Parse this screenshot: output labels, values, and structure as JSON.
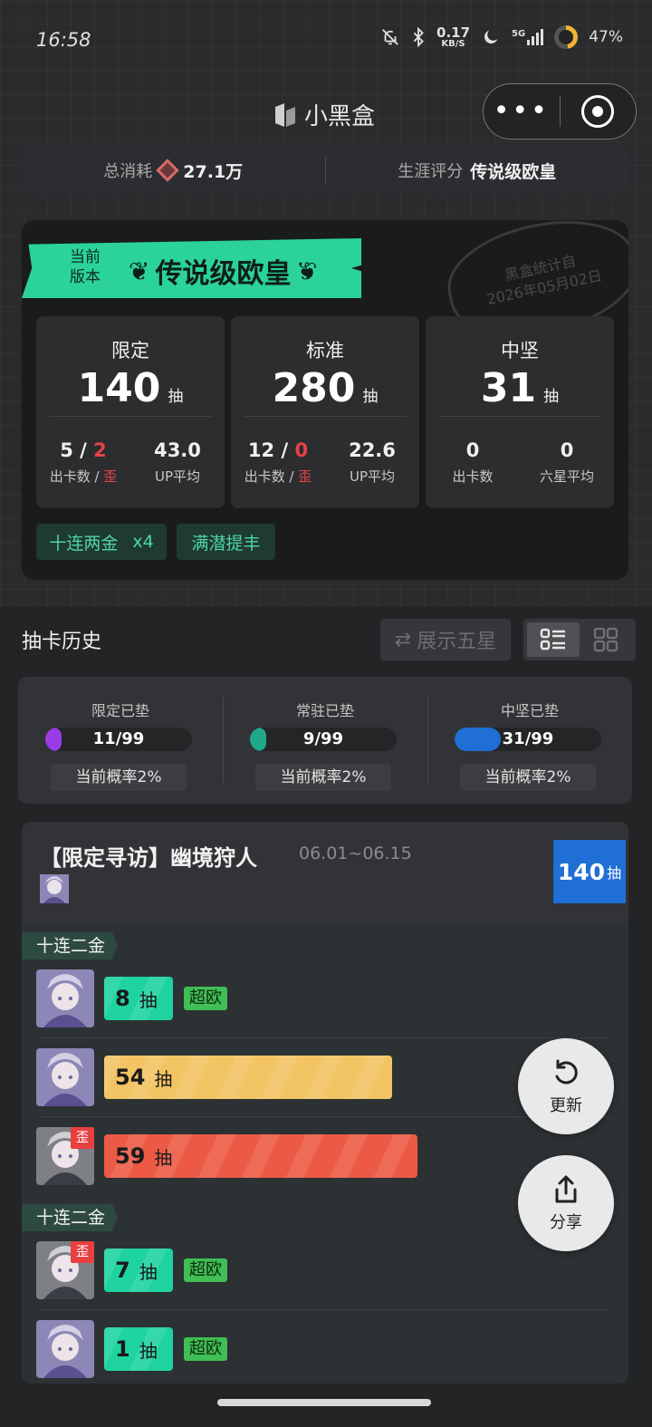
{
  "status_bar": {
    "time": "16:58",
    "net_speed": "0.17",
    "net_unit": "KB/S",
    "signal": "5G",
    "battery": "47%"
  },
  "header": {
    "app_name": "小黑盒",
    "menu_label": "•••"
  },
  "summary": {
    "consume_label": "总消耗",
    "consume_value": "27.1万",
    "score_label": "生涯评分",
    "score_value": "传说级欧皇"
  },
  "version_card": {
    "banner_sub": "当前版本",
    "banner_title": "传说级欧皇",
    "stamp_line1": "黑盒统计自",
    "stamp_line2": "2026年05月02日",
    "stats": [
      {
        "title": "限定",
        "pulls": "140",
        "unit": "抽",
        "left_a": "5",
        "left_sep": " / ",
        "left_b": "2",
        "left_lbl_a": "出卡数 / ",
        "left_lbl_b": "歪",
        "right_val": "43.0",
        "right_lbl": "UP平均"
      },
      {
        "title": "标准",
        "pulls": "280",
        "unit": "抽",
        "left_a": "12",
        "left_sep": " / ",
        "left_b": "0",
        "left_lbl_a": "出卡数 / ",
        "left_lbl_b": "歪",
        "right_val": "22.6",
        "right_lbl": "UP平均"
      },
      {
        "title": "中坚",
        "pulls": "31",
        "unit": "抽",
        "left_a": "0",
        "left_sep": "",
        "left_b": "",
        "left_lbl_a": "出卡数",
        "left_lbl_b": "",
        "right_val": "0",
        "right_lbl": "六星平均"
      }
    ],
    "chips": [
      "十连两金",
      "x4",
      "满潜提丰"
    ]
  },
  "history": {
    "title": "抽卡历史",
    "filter_label": "展示五星",
    "pity": [
      {
        "label": "限定已垫",
        "value": "11/99",
        "fraction": 0.111,
        "color": "#9b3be8",
        "rate": "当前概率2%"
      },
      {
        "label": "常驻已垫",
        "value": "9/99",
        "fraction": 0.091,
        "color": "#1fa88a",
        "rate": "当前概率2%"
      },
      {
        "label": "中坚已垫",
        "value": "31/99",
        "fraction": 0.313,
        "color": "#1f6fd6",
        "rate": "当前概率2%"
      }
    ]
  },
  "pool": {
    "name": "【限定寻访】幽境狩人",
    "date": "06.01~06.15",
    "total": "140",
    "unit": "抽",
    "groups": [
      {
        "tag": "十连二金",
        "rows": [
          {
            "pulls": "8",
            "unit": "抽",
            "fraction": 0.08,
            "color": "#1fd3a0",
            "badge": "超欧",
            "off": ""
          },
          {
            "pulls": "54",
            "unit": "抽",
            "fraction": 0.54,
            "color": "#f2c463",
            "badge": "",
            "off": ""
          },
          {
            "pulls": "59",
            "unit": "抽",
            "fraction": 0.59,
            "color": "#ec5a45",
            "badge": "",
            "off": "歪"
          }
        ]
      },
      {
        "tag": "十连二金",
        "rows": [
          {
            "pulls": "7",
            "unit": "抽",
            "fraction": 0.07,
            "color": "#1fd3a0",
            "badge": "超欧",
            "off": "歪"
          },
          {
            "pulls": "1",
            "unit": "抽",
            "fraction": 0.01,
            "color": "#1fd3a0",
            "badge": "超欧",
            "off": ""
          }
        ]
      }
    ]
  },
  "fab": {
    "refresh_label": "更新",
    "share_label": "分享"
  }
}
